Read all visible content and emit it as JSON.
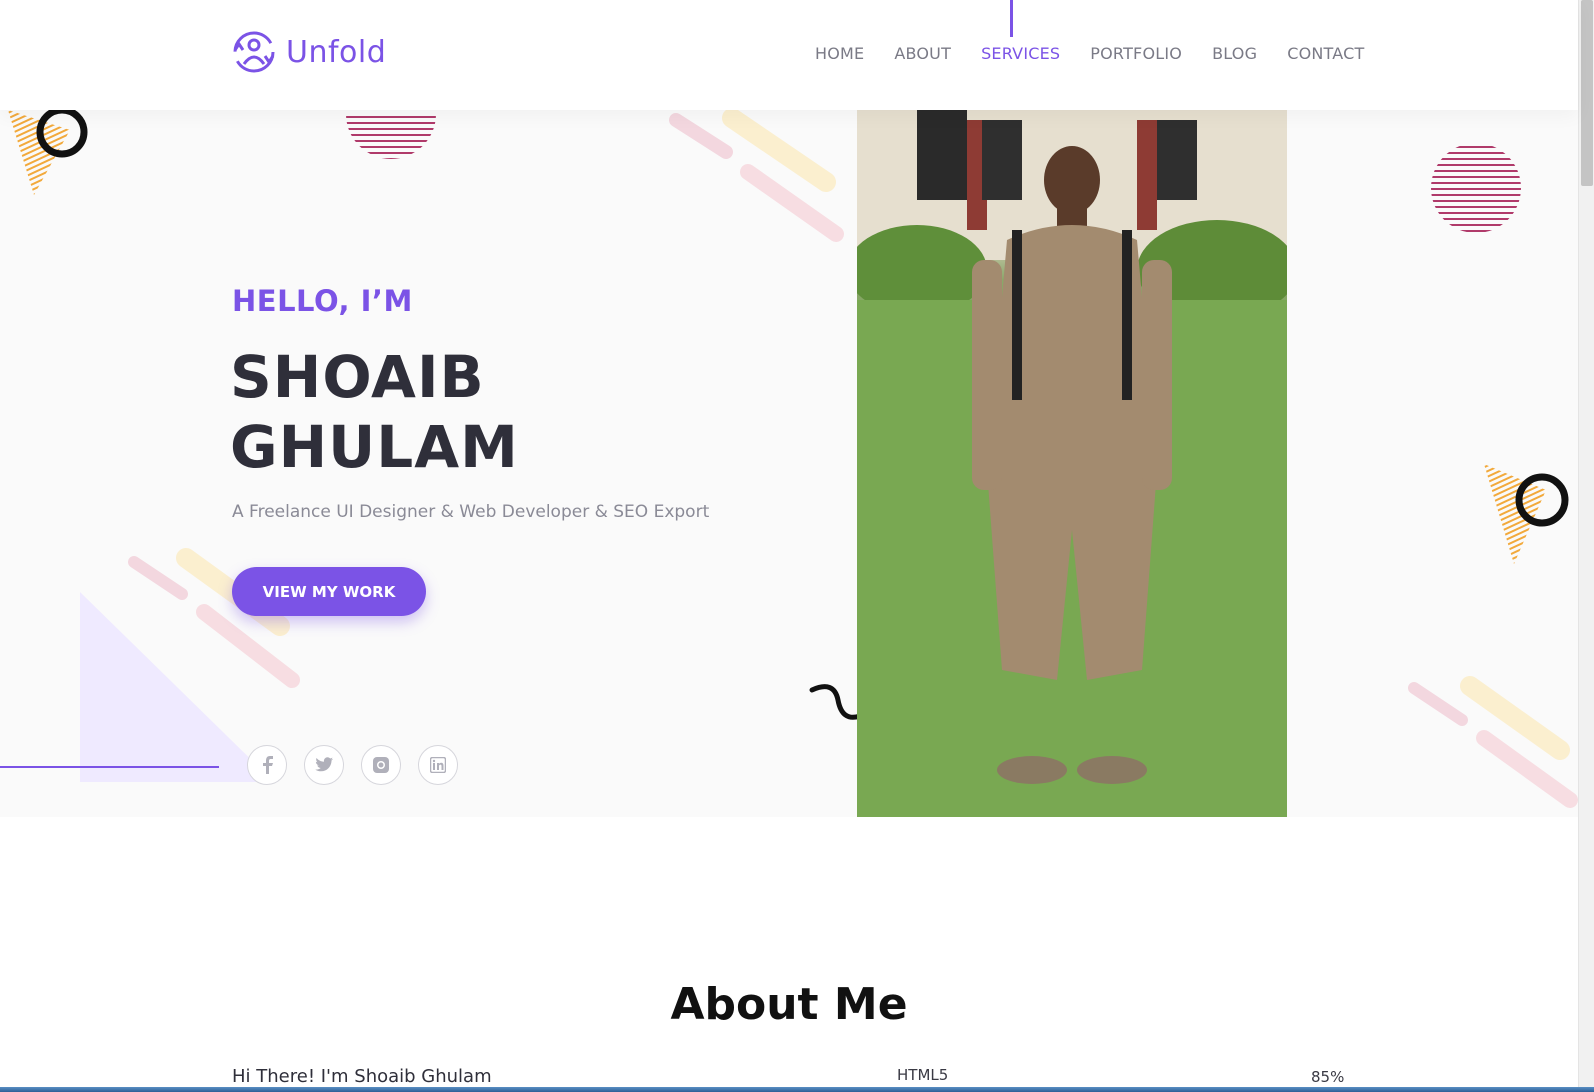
{
  "brand": {
    "name": "Unfold"
  },
  "nav": {
    "items": [
      "HOME",
      "ABOUT",
      "SERVICES",
      "PORTFOLIO",
      "BLOG",
      "CONTACT"
    ],
    "active": "SERVICES"
  },
  "hero": {
    "greeting": "HELLO, I’M",
    "first_name": "SHOAIB",
    "last_name": "GHULAM",
    "tagline": "A Freelance UI Designer & Web Developer & SEO Export",
    "cta": "VIEW MY WORK",
    "socials": [
      "facebook-icon",
      "twitter-icon",
      "instagram-icon",
      "linkedin-icon"
    ]
  },
  "about": {
    "title": "About Me",
    "intro": "Hi There! I'm Shoaib Ghulam",
    "skill": {
      "name": "HTML5",
      "percent": "85%"
    }
  },
  "colors": {
    "accent": "#7b53e6",
    "heading": "#2f2f3a",
    "muted": "#8a8a96",
    "decor_pink": "#b03a6a",
    "decor_yellow": "#f2a93b",
    "decor_lavender": "#efeaff"
  }
}
